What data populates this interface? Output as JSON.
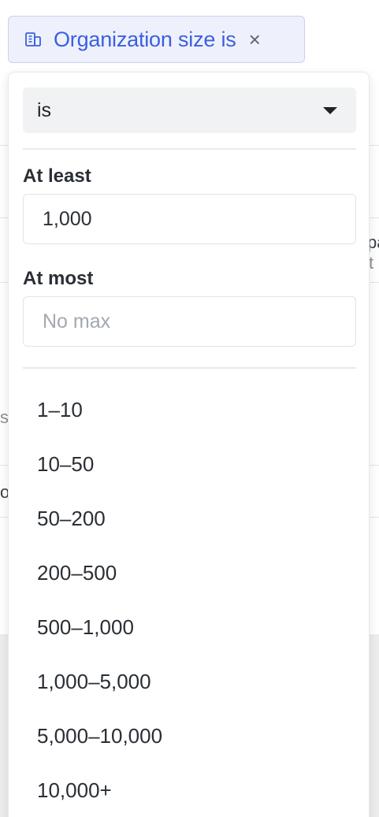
{
  "filter_chip": {
    "icon": "building-icon",
    "label": "Organization size is",
    "close_glyph": "×",
    "accent_color": "#3b5fe0"
  },
  "background": {
    "fragment_1": "pa",
    "fragment_2": "t",
    "fragment_3": "s",
    "fragment_4": "o"
  },
  "panel": {
    "operator": {
      "value": "is"
    },
    "at_least": {
      "label": "At least",
      "value": "1,000",
      "placeholder": ""
    },
    "at_most": {
      "label": "At most",
      "value": "",
      "placeholder": "No max"
    },
    "options": [
      "1–10",
      "10–50",
      "50–200",
      "200–500",
      "500–1,000",
      "1,000–5,000",
      "5,000–10,000",
      "10,000+"
    ]
  }
}
